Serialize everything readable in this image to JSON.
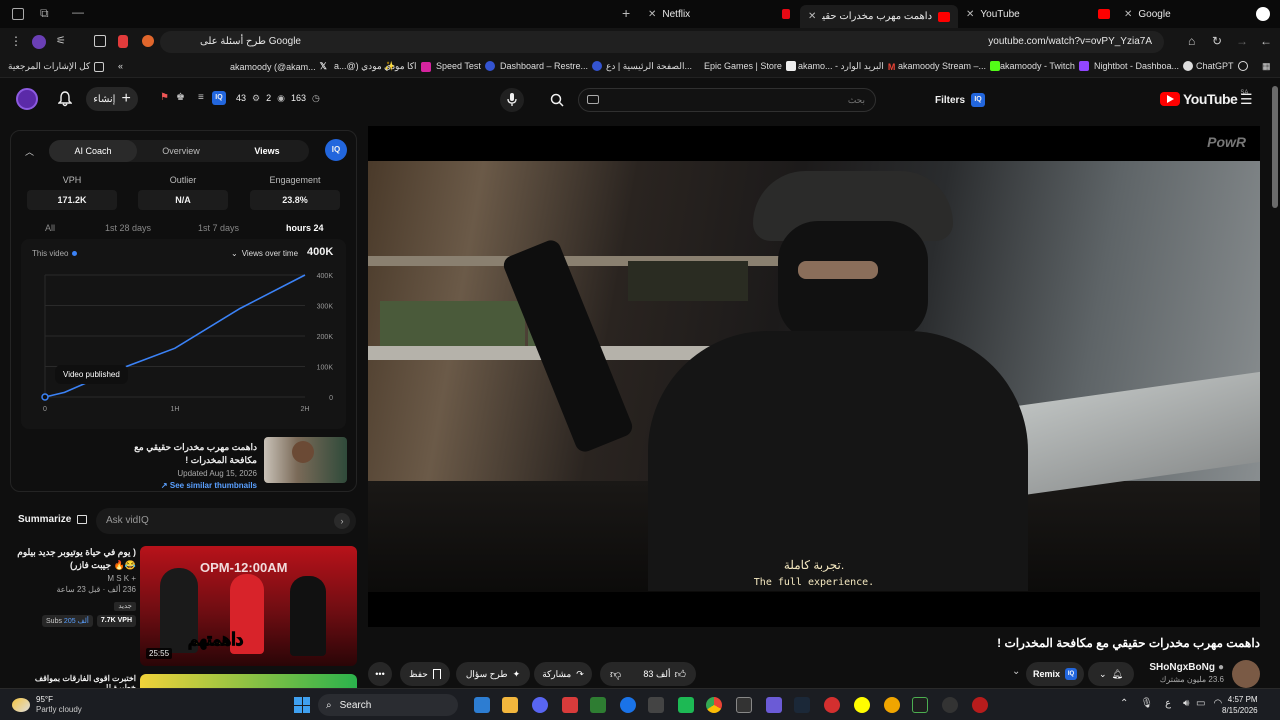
{
  "browser": {
    "tabs": [
      {
        "label": "Netflix",
        "favicon_color": "#e50914"
      },
      {
        "label": "داهمت مهرب مخدرات حقيقي مع",
        "favicon_color": "#ff0000",
        "active": true
      },
      {
        "label": "YouTube",
        "favicon_color": "#ff0000"
      },
      {
        "label": "Google",
        "favicon_color": "#ffffff"
      }
    ],
    "google_prompt": "طرح أسئلة على Google",
    "url": "youtube.com/watch?v=ovPY_Yzia7A",
    "bookmarks": [
      "كل الإشارات المرجعية",
      "akamoody (@akam...",
      "a...@) مودي ✨",
      "اكا مودي",
      "Speed Test",
      "Dashboard – Restre...",
      "الصفحة الرئيسية | دع...",
      "Epic Games | Store",
      "akamo... - البريد الوارد",
      "akamoody Stream –...",
      "akamoody - Twitch",
      "Nightbot - Dashboa...",
      "ChatGPT"
    ]
  },
  "yt_header": {
    "create_label": "إنشاء",
    "stats": {
      "a": "43",
      "b": "2",
      "c": "163"
    },
    "search_placeholder": "بحث",
    "filters_label": "Filters",
    "logo_text": "YouTube",
    "country": "SA"
  },
  "vidiq": {
    "tabs": [
      "AI Coach",
      "Overview",
      "Views"
    ],
    "active_tab": "Views",
    "badge": "IQ",
    "stats": [
      {
        "label": "VPH",
        "value": "171.2K"
      },
      {
        "label": "Outlier",
        "value": "N/A"
      },
      {
        "label": "Engagement",
        "value": "23.8%"
      }
    ],
    "ranges": [
      "All",
      "1st 28 days",
      "1st 7 days",
      "hours 24"
    ],
    "active_range": "hours 24",
    "this_video_label": "This video",
    "dropdown_label": "Views over time",
    "current_value": "400K",
    "published_tooltip": "Video published",
    "video": {
      "title": "داهمت مهرب مخدرات حقيقي مع مكافحة المخدرات !",
      "updated": "Updated Aug 15, 2026",
      "similar": "See similar thumbnails"
    },
    "summarize_label": "Summarize",
    "ask_placeholder": "Ask vidIQ"
  },
  "chart_data": {
    "type": "line",
    "title": "Views over time",
    "x_ticks": [
      "0",
      "1H",
      "2H"
    ],
    "y_ticks": [
      "0",
      "100K",
      "200K",
      "300K",
      "400K"
    ],
    "ylim": [
      0,
      400000
    ],
    "xlim": [
      0,
      2
    ],
    "series": [
      {
        "name": "This video",
        "points": [
          [
            0,
            0
          ],
          [
            0.15,
            15000
          ],
          [
            0.5,
            80000
          ],
          [
            1.0,
            160000
          ],
          [
            1.5,
            290000
          ],
          [
            2.0,
            400000
          ]
        ]
      }
    ],
    "grid": true
  },
  "related": [
    {
      "title": "( يوم في حياة يوتيوبر جديد بيلوم 😂🔥 جيبت فازر)",
      "channel": "M S K +",
      "meta": "236 ألف  ·  قبل 23 ساعة",
      "badge": "جديد",
      "subs": "205 ألف",
      "vph": "7.7K VPH",
      "duration": "25:55",
      "thumb_text": "داهمتهم"
    },
    {
      "title": "اختبرت اقوى الفارقات بمواقف خطيرة !!"
    }
  ],
  "player": {
    "subtitle_ar": "تجربة كاملة.",
    "subtitle_en": "The full experience.",
    "watermark": "PowR"
  },
  "video": {
    "title": "داهمت مهرب مخدرات حقيقي مع مكافحة المخدرات !",
    "channel": "SHoNgxBoNg",
    "subscribers": "23.6 مليون مشترك",
    "remix": "Remix",
    "likes": "83 ألف",
    "share": "مشاركة",
    "ask": "طرح سؤال",
    "save": "حفظ"
  },
  "taskbar": {
    "weather_temp": "95°F",
    "weather_desc": "Partly cloudy",
    "search": "Search",
    "time": "4:57 PM",
    "date": "8/15/2026"
  }
}
